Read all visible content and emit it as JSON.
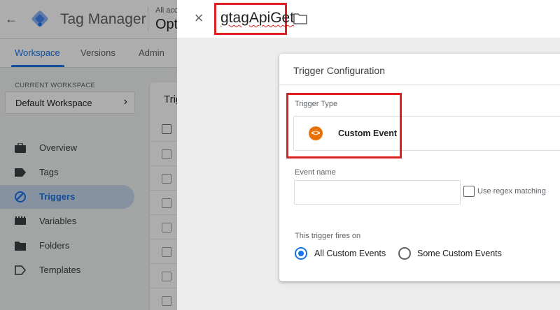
{
  "app": {
    "title": "Tag Manager",
    "account_line": "All acco",
    "container_line": "Opt"
  },
  "tabs": [
    {
      "label": "Workspace",
      "active": true
    },
    {
      "label": "Versions",
      "active": false
    },
    {
      "label": "Admin",
      "active": false
    }
  ],
  "sidebar": {
    "current_workspace_label": "CURRENT WORKSPACE",
    "workspace_name": "Default Workspace",
    "items": [
      {
        "label": "Overview",
        "icon": "briefcase-icon",
        "active": false
      },
      {
        "label": "Tags",
        "icon": "tag-icon",
        "active": false
      },
      {
        "label": "Triggers",
        "icon": "trigger-icon",
        "active": true
      },
      {
        "label": "Variables",
        "icon": "variables-icon",
        "active": false
      },
      {
        "label": "Folders",
        "icon": "folder-icon",
        "active": false
      },
      {
        "label": "Templates",
        "icon": "template-icon",
        "active": false
      }
    ]
  },
  "content": {
    "heading": "Trig"
  },
  "sheet": {
    "name": "gtagApiGet",
    "card_title": "Trigger Configuration",
    "trigger_type_label": "Trigger Type",
    "trigger_type_name": "Custom Event",
    "trigger_type_icon_glyph": "<>",
    "event_name_label": "Event name",
    "event_name_value": "",
    "regex_label": "Use regex matching",
    "fires_on_label": "This trigger fires on",
    "fires_options": [
      {
        "label": "All Custom Events",
        "selected": true
      },
      {
        "label": "Some Custom Events",
        "selected": false
      }
    ]
  },
  "colors": {
    "accent": "#1a73e8",
    "highlight": "#e02020",
    "custom_event_icon": "#e8710a",
    "nav_active_bg": "#c8d7ec"
  }
}
